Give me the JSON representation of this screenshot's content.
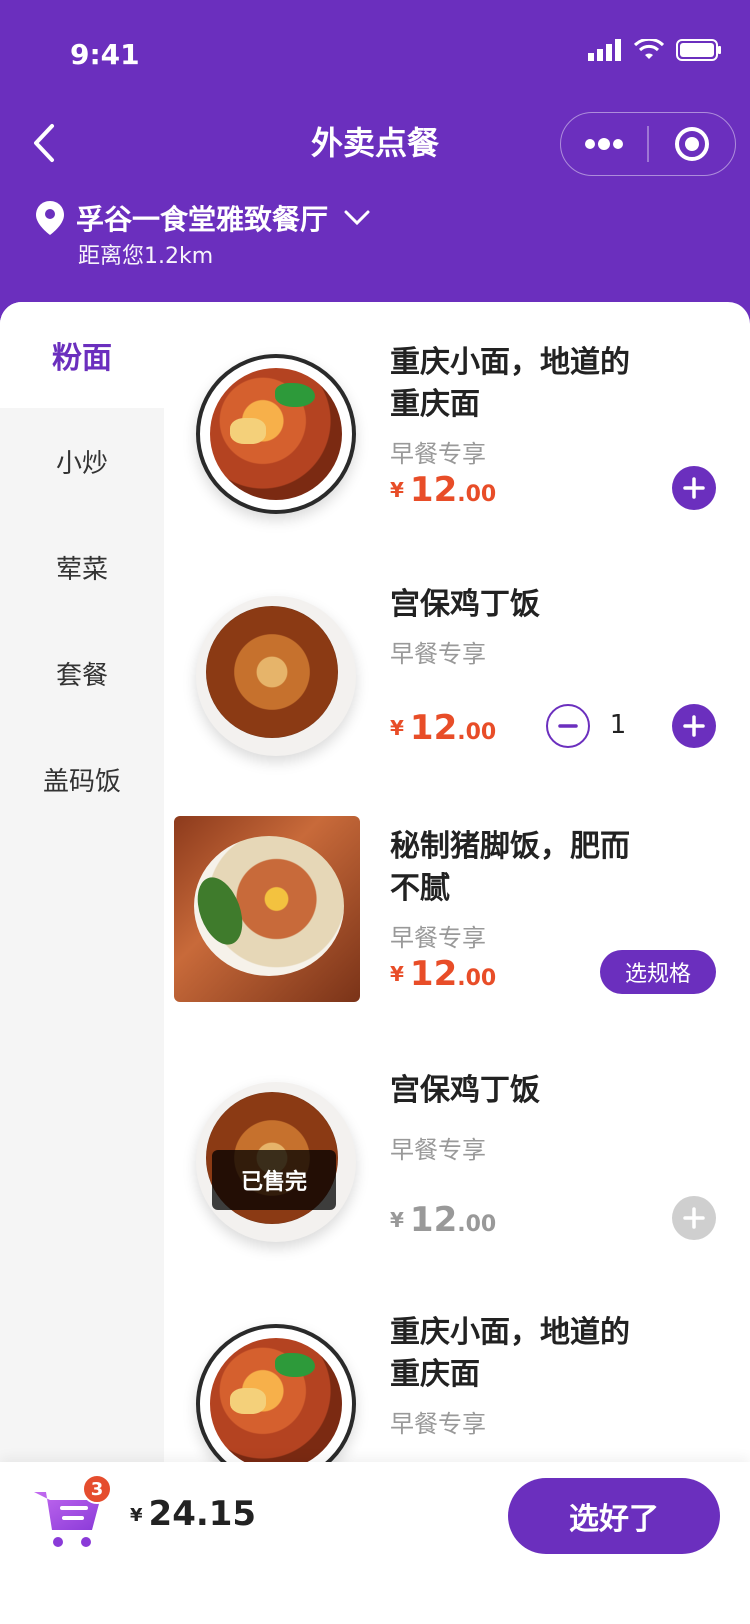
{
  "status_bar": {
    "time": "9:41"
  },
  "header": {
    "title": "外卖点餐",
    "store_name": "孚谷一食堂雅致餐厅",
    "store_distance": "距离您1.2km",
    "capsule_more_icon": "more-dots-icon",
    "capsule_close_icon": "target-circle-icon"
  },
  "colors": {
    "primary": "#6b2fbe",
    "price": "#e84d28",
    "badge": "#e54d2e"
  },
  "categories": [
    {
      "label": "粉面",
      "active": true
    },
    {
      "label": "小炒"
    },
    {
      "label": "荤菜"
    },
    {
      "label": "套餐"
    },
    {
      "label": "盖码饭"
    }
  ],
  "items": [
    {
      "name_line1": "重庆小面，地道的",
      "name_line2": "重庆面",
      "desc": "早餐专享",
      "price_int": "12",
      "price_dec": ".00",
      "currency": "¥",
      "action": "add"
    },
    {
      "name_line1": "宫保鸡丁饭",
      "desc": "早餐专享",
      "price_int": "12",
      "price_dec": ".00",
      "currency": "¥",
      "action": "stepper",
      "quantity": "1"
    },
    {
      "name_line1": "秘制猪脚饭，肥而",
      "name_line2": "不腻",
      "desc": "早餐专享",
      "price_int": "12",
      "price_dec": ".00",
      "currency": "¥",
      "action": "spec",
      "spec_label": "选规格"
    },
    {
      "name_line1": "宫保鸡丁饭",
      "desc": "早餐专享",
      "price_int": "12",
      "price_dec": ".00",
      "currency": "¥",
      "action": "add-disabled",
      "soldout_label": "已售完"
    },
    {
      "name_line1": "重庆小面，地道的",
      "name_line2": "重庆面",
      "desc": "早餐专享"
    }
  ],
  "cart": {
    "badge_count": "3",
    "currency": "¥",
    "total": "24.15",
    "confirm_label": "选好了"
  }
}
